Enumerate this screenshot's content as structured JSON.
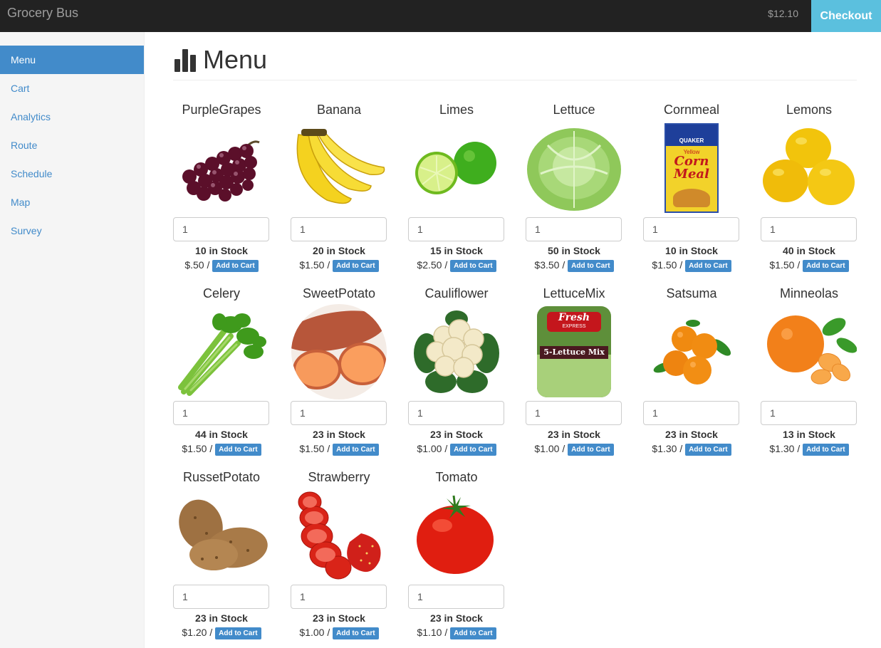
{
  "navbar": {
    "brand": "Grocery Bus",
    "cart_total": "$12.10",
    "checkout_label": "Checkout"
  },
  "sidebar": {
    "items": [
      {
        "label": "Menu",
        "active": true
      },
      {
        "label": "Cart"
      },
      {
        "label": "Analytics"
      },
      {
        "label": "Route"
      },
      {
        "label": "Schedule"
      },
      {
        "label": "Map"
      },
      {
        "label": "Survey"
      }
    ]
  },
  "main": {
    "title": "Menu",
    "title_icon": "bar-chart-icon",
    "add_label": "Add to Cart",
    "products": [
      {
        "name": "PurpleGrapes",
        "qty": "1",
        "stock": "10 in Stock",
        "price": "$.50 /",
        "icon": "grapes-icon"
      },
      {
        "name": "Banana",
        "qty": "1",
        "stock": "20 in Stock",
        "price": "$1.50 /",
        "icon": "banana-icon"
      },
      {
        "name": "Limes",
        "qty": "1",
        "stock": "15 in Stock",
        "price": "$2.50 /",
        "icon": "lime-icon"
      },
      {
        "name": "Lettuce",
        "qty": "1",
        "stock": "50 in Stock",
        "price": "$3.50 /",
        "icon": "lettuce-icon"
      },
      {
        "name": "Cornmeal",
        "qty": "1",
        "stock": "10 in Stock",
        "price": "$1.50 /",
        "icon": "cornmeal-box-icon"
      },
      {
        "name": "Lemons",
        "qty": "1",
        "stock": "40 in Stock",
        "price": "$1.50 /",
        "icon": "lemon-icon"
      },
      {
        "name": "Celery",
        "qty": "1",
        "stock": "44 in Stock",
        "price": "$1.50 /",
        "icon": "celery-icon"
      },
      {
        "name": "SweetPotato",
        "qty": "1",
        "stock": "23 in Stock",
        "price": "$1.50 /",
        "icon": "sweet-potato-icon"
      },
      {
        "name": "Cauliflower",
        "qty": "1",
        "stock": "23 in Stock",
        "price": "$1.00 /",
        "icon": "cauliflower-icon"
      },
      {
        "name": "LettuceMix",
        "qty": "1",
        "stock": "23 in Stock",
        "price": "$1.00 /",
        "icon": "lettuce-mix-bag-icon"
      },
      {
        "name": "Satsuma",
        "qty": "1",
        "stock": "23 in Stock",
        "price": "$1.30 /",
        "icon": "satsuma-icon"
      },
      {
        "name": "Minneolas",
        "qty": "1",
        "stock": "13 in Stock",
        "price": "$1.30 /",
        "icon": "minneola-icon"
      },
      {
        "name": "RussetPotato",
        "qty": "1",
        "stock": "23 in Stock",
        "price": "$1.20 /",
        "icon": "potato-icon"
      },
      {
        "name": "Strawberry",
        "qty": "1",
        "stock": "23 in Stock",
        "price": "$1.00 /",
        "icon": "strawberry-icon"
      },
      {
        "name": "Tomato",
        "qty": "1",
        "stock": "23 in Stock",
        "price": "$1.10 /",
        "icon": "tomato-icon"
      }
    ]
  },
  "image_text": {
    "cornmeal_brand": "QUAKER",
    "cornmeal_sub": "Yellow",
    "cornmeal_line1": "Corn",
    "cornmeal_line2": "Meal",
    "lettucemix_brand": "Fresh",
    "lettucemix_brand2": "EXPRESS",
    "lettucemix_label": "5-Lettuce Mix"
  }
}
